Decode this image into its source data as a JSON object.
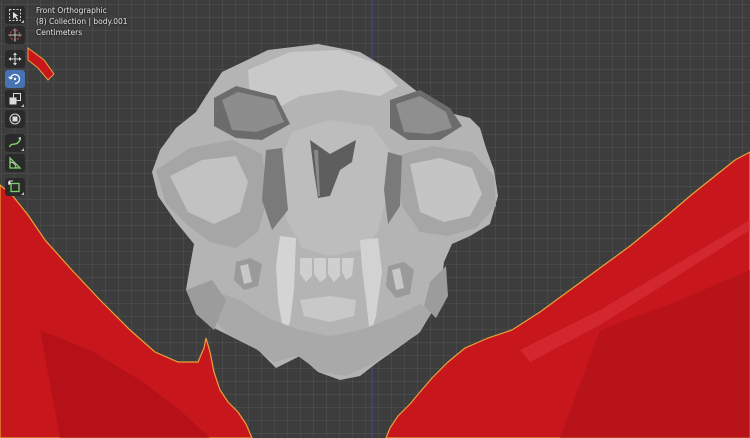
{
  "viewport": {
    "view_name": "Front Orthographic",
    "collection_info": "(8) Collection | body.001",
    "units": "Centimeters"
  },
  "toolbar": {
    "tools": [
      {
        "icon": "select-box-icon",
        "active": false
      },
      {
        "icon": "cursor-icon",
        "active": false
      },
      {
        "icon": "move-icon",
        "active": false
      },
      {
        "icon": "rotate-icon",
        "active": true
      },
      {
        "icon": "scale-icon",
        "active": false
      },
      {
        "icon": "transform-icon",
        "active": false
      },
      {
        "icon": "annotate-icon",
        "active": false
      },
      {
        "icon": "measure-icon",
        "active": false
      },
      {
        "icon": "add-cube-icon",
        "active": false
      }
    ]
  },
  "colors": {
    "background": "#3d3d3d",
    "grid": "#4a4a4a",
    "axis_y": "#3a4a9a",
    "skull": "#b9b9b9",
    "body_selected": "#c8161d",
    "selection_outline": "#e8a23a",
    "active_tool": "#4772b3"
  }
}
